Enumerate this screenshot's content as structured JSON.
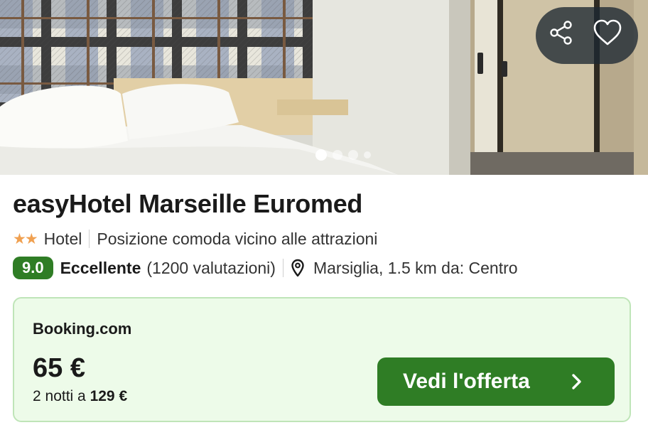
{
  "hotel": {
    "name": "easyHotel Marseille Euromed",
    "stars": 2,
    "stars_glyphs": "★★",
    "type": "Hotel",
    "tagline": "Posizione comoda vicino alle attrazioni",
    "score": "9.0",
    "rating_label": "Eccellente",
    "reviews": "(1200 valutazioni)",
    "location": "Marsiglia, 1.5 km da: Centro"
  },
  "gallery": {
    "image_count_visible": 4,
    "active_index": 0
  },
  "offer": {
    "provider": "Booking.com",
    "price": "65 €",
    "nights_prefix": "2 notti a",
    "nights_total": "129 €",
    "cta_label": "Vedi l'offerta"
  },
  "icons": {
    "share": "share-icon",
    "favorite": "heart-icon",
    "location": "map-pin-icon",
    "cta_arrow": "chevron-right-icon",
    "star": "star-icon"
  },
  "colors": {
    "score_bg": "#2f7d25",
    "cta_bg": "#2f7d25",
    "offer_bg": "#edfbe9",
    "offer_border": "#bfe5b8",
    "star": "#f0a050"
  }
}
